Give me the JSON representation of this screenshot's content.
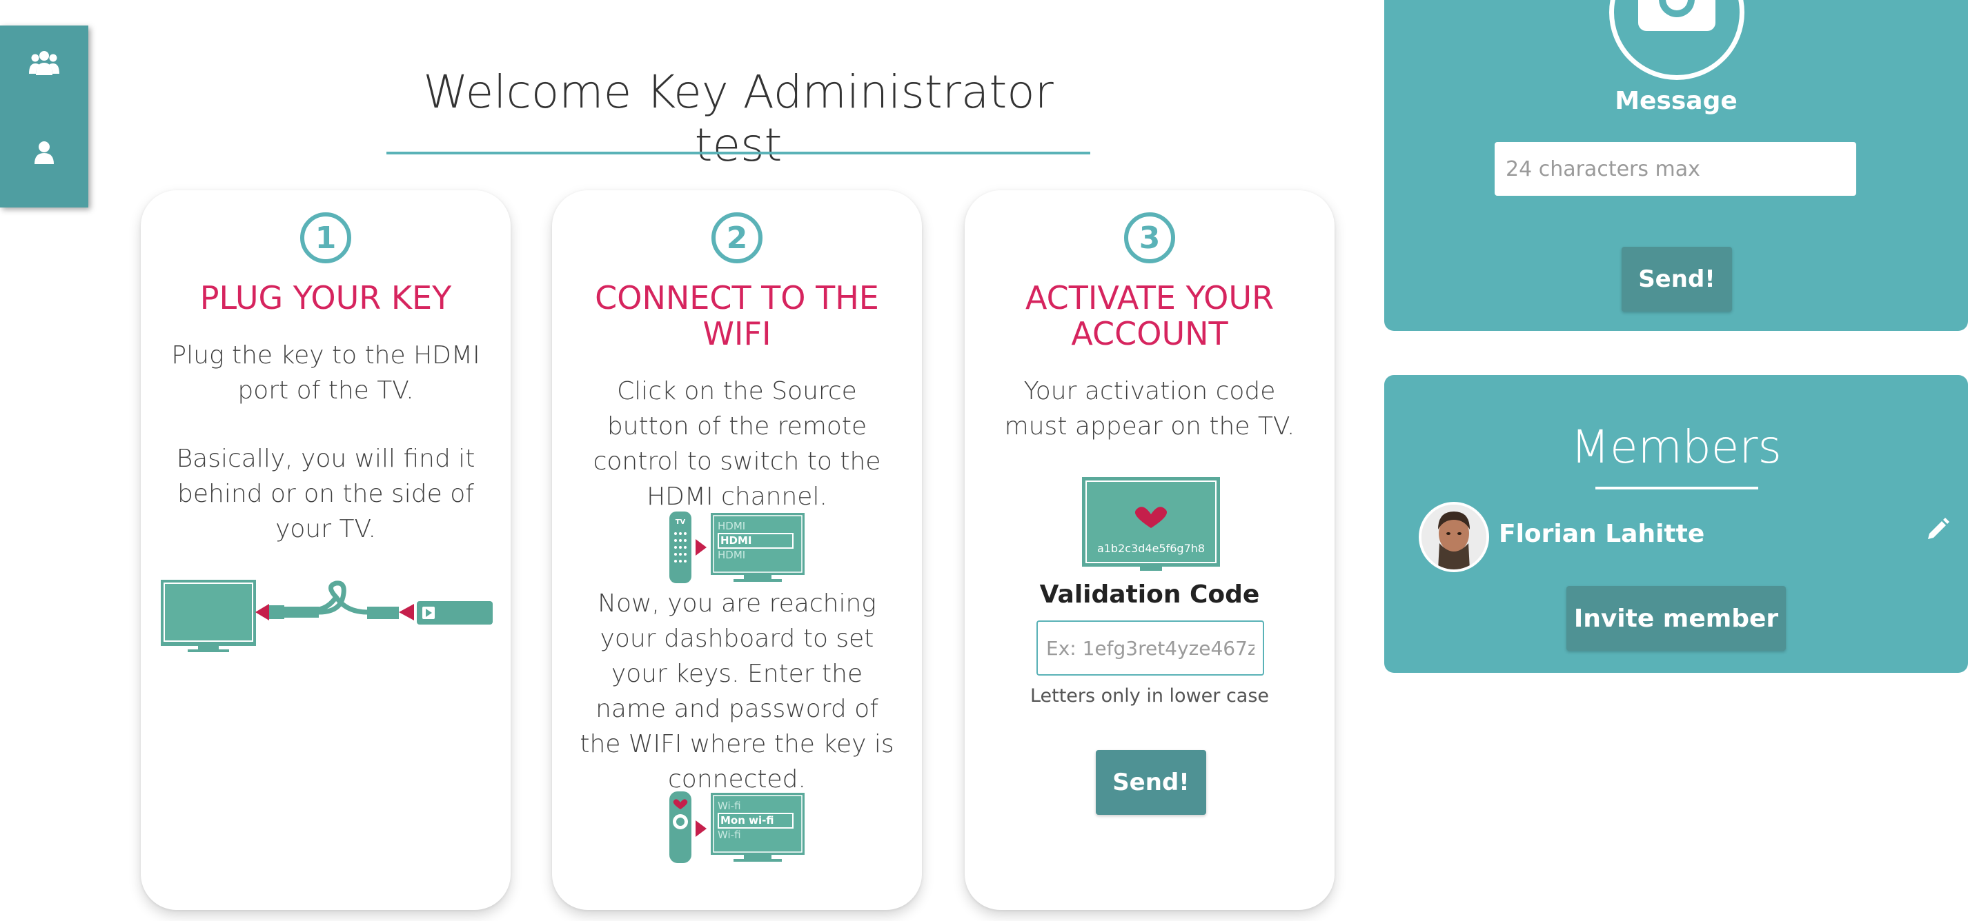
{
  "nav": {
    "items": [
      {
        "name": "members-icon"
      },
      {
        "name": "user-icon"
      }
    ]
  },
  "welcome": {
    "title": "Welcome Key Administrator test"
  },
  "steps": [
    {
      "number": "1",
      "title": "PLUG YOUR KEY",
      "text1": "Plug the key to the HDMI port of the TV.",
      "text2": "Basically, you will find it behind or on the side of your TV."
    },
    {
      "number": "2",
      "title": "CONNECT TO THE WIFI",
      "text1": "Click on the Source button of the remote control to switch to the HDMI channel.",
      "hdmi_labels": [
        "HDMI",
        "HDMI",
        "HDMI"
      ],
      "text2": "Now, you are reaching your dashboard to set your keys. Enter the name and password of the WIFI where the key is connected.",
      "wifi_labels": [
        "Wi-fi",
        "Mon wi-fi",
        "Wi-fi"
      ]
    },
    {
      "number": "3",
      "title": "ACTIVATE YOUR ACCOUNT",
      "text1": "Your activation code must appear on the TV.",
      "tv_code": "a1b2c3d4e5f6g7h8",
      "validation_label": "Validation Code",
      "validation_placeholder": "Ex: 1efg3ret4yze467z",
      "validation_hint": "Letters only in lower case",
      "send_label": "Send!"
    }
  ],
  "message_panel": {
    "label": "Message",
    "placeholder": "24 characters max",
    "send_label": "Send!"
  },
  "members_panel": {
    "title": "Members",
    "members": [
      {
        "name": "Florian Lahitte"
      }
    ],
    "invite_label": "Invite member"
  },
  "colors": {
    "teal": "#5ab2b7",
    "teal_dark": "#4f9294",
    "pink": "#d6245e"
  }
}
